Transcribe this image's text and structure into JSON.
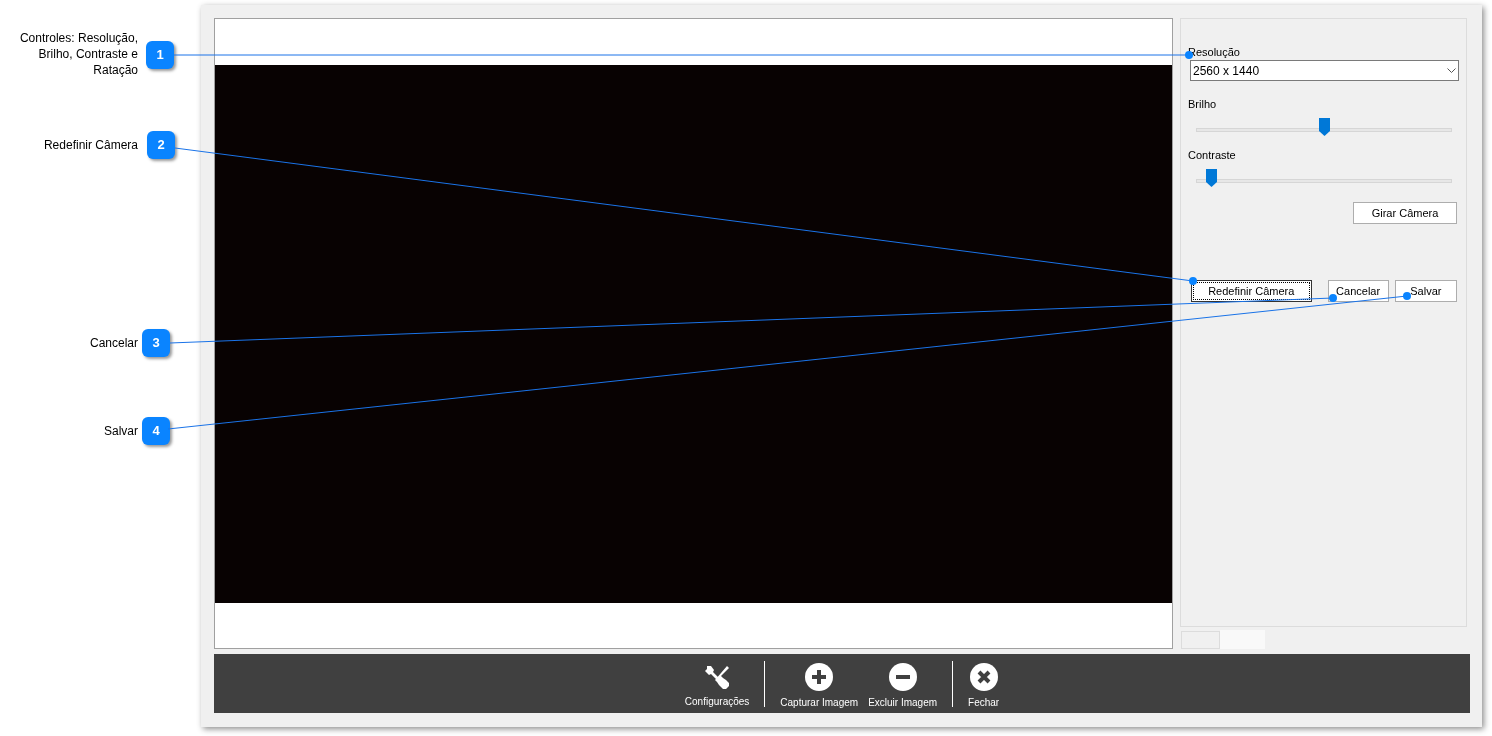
{
  "callouts": [
    {
      "number": "1",
      "label": "Controles: Resolução, Brilho, Contraste e Ratação"
    },
    {
      "number": "2",
      "label": "Redefinir Câmera"
    },
    {
      "number": "3",
      "label": "Cancelar"
    },
    {
      "number": "4",
      "label": "Salvar"
    }
  ],
  "controls": {
    "resolution_label": "Resolução",
    "resolution_value": "2560 x 1440",
    "sliders": [
      {
        "label": "Brilho",
        "level": 0.5
      },
      {
        "label": "Contraste",
        "level": 0.06
      }
    ],
    "rotate_button": "Girar Câmera"
  },
  "actions": [
    {
      "label": "Redefinir Câmera",
      "focused": true
    },
    {
      "label": "Cancelar",
      "focused": false
    },
    {
      "label": "Salvar",
      "focused": false
    }
  ],
  "tabs": [
    {
      "selected": false
    },
    {
      "selected": true
    }
  ],
  "toolbar": [
    [
      {
        "kind": "tools",
        "label": "Configurações"
      }
    ],
    [
      {
        "kind": "plus",
        "label": "Capturar Imagem"
      },
      {
        "kind": "minus",
        "label": "Excluir Imagem"
      }
    ],
    [
      {
        "kind": "close",
        "label": "Fechar"
      }
    ]
  ]
}
